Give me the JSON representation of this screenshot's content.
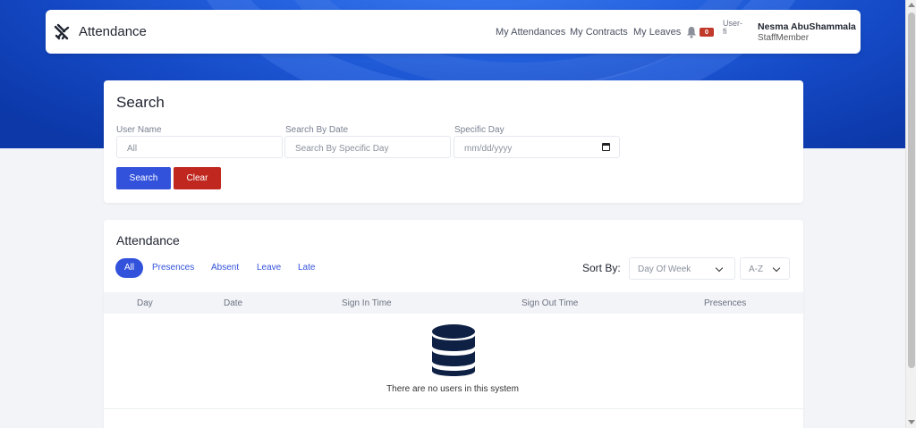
{
  "app": {
    "title": "Attendance"
  },
  "nav": {
    "links": [
      "My Attendances",
      "My Contracts",
      "My Leaves"
    ],
    "notification_count": "0",
    "avatar_alt": "User-fi",
    "user_name": "Nesma AbuShammala",
    "user_role": "StaffMember"
  },
  "search": {
    "title": "Search",
    "user_name_label": "User Name",
    "user_name_placeholder": "All",
    "date_label": "Search By Date",
    "date_placeholder": "Search By Specific Day",
    "day_label": "Specific Day",
    "day_placeholder": "mm/dd/yyyy",
    "search_button": "Search",
    "clear_button": "Clear"
  },
  "attendance": {
    "title": "Attendance",
    "filters": [
      "All",
      "Presences",
      "Absent",
      "Leave",
      "Late"
    ],
    "active_filter": "All",
    "sort_label": "Sort By:",
    "sort_field": "Day Of Week",
    "sort_order": "A-Z",
    "columns": [
      "Day",
      "Date",
      "Sign In Time",
      "Sign Out Time",
      "Presences"
    ],
    "rows": [],
    "empty_message": "There are no users in this system"
  },
  "colors": {
    "primary": "#3352dc",
    "danger": "#c0271f",
    "hero": "#1f5ad6",
    "badge": "#c0392b"
  }
}
